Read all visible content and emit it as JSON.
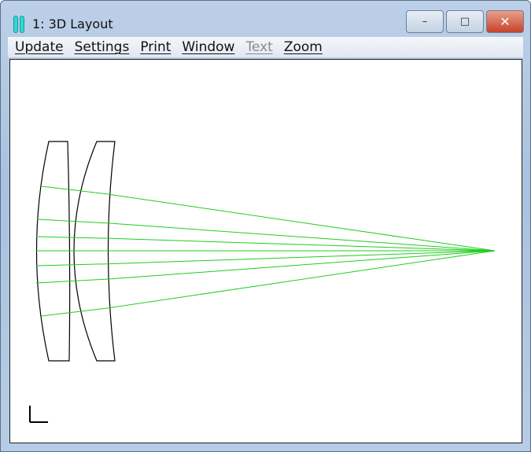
{
  "window": {
    "title": "1: 3D Layout",
    "icon": "lens-app-icon",
    "minimize": "–",
    "maximize": "□",
    "close": "✕"
  },
  "menu": [
    {
      "label": "Update",
      "enabled": true
    },
    {
      "label": "Settings",
      "enabled": true
    },
    {
      "label": "Print",
      "enabled": true
    },
    {
      "label": "Window",
      "enabled": true
    },
    {
      "label": "Text",
      "enabled": false
    },
    {
      "label": "Zoom",
      "enabled": true
    }
  ],
  "colors": {
    "ray": "#22cc22",
    "lens": "#000000"
  }
}
